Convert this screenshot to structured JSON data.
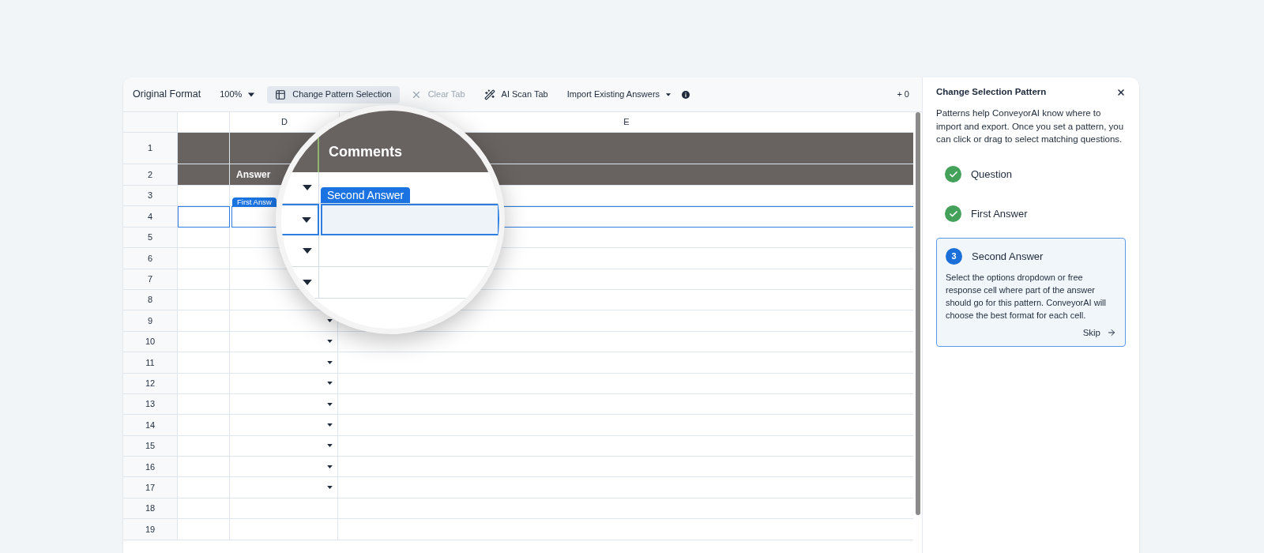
{
  "toolbar": {
    "title": "Original Format",
    "zoom": "100%",
    "buttons": [
      {
        "kind": "table",
        "label": "Change Pattern Selection",
        "selected": true,
        "disabled": false
      },
      {
        "kind": "clear",
        "label": "Clear Tab",
        "selected": false,
        "disabled": true
      },
      {
        "kind": "wand",
        "label": "AI Scan Tab",
        "selected": false,
        "disabled": false
      },
      {
        "kind": "menu",
        "label": "Import Existing Answers",
        "selected": false,
        "disabled": false
      }
    ],
    "counter": "+ 0"
  },
  "sheet": {
    "columns": [
      "D",
      "E"
    ],
    "rows": [
      {
        "label": "1",
        "kind": "header",
        "selected": false
      },
      {
        "label": "2",
        "kind": "header",
        "selected": false,
        "answer": "Answer"
      },
      {
        "label": "3",
        "kind": "data",
        "selected": false
      },
      {
        "label": "4",
        "kind": "data",
        "selected": true,
        "tag": "First Answ"
      },
      {
        "label": "5",
        "kind": "data",
        "selected": false
      },
      {
        "label": "6",
        "kind": "data",
        "selected": false
      },
      {
        "label": "7",
        "kind": "data",
        "selected": false
      },
      {
        "label": "8",
        "kind": "data",
        "selected": false
      },
      {
        "label": "9",
        "kind": "data",
        "selected": false,
        "dropdown": true
      },
      {
        "label": "10",
        "kind": "data",
        "selected": false,
        "dropdown": true
      },
      {
        "label": "11",
        "kind": "data",
        "selected": false,
        "dropdown": true
      },
      {
        "label": "12",
        "kind": "data",
        "selected": false,
        "dropdown": true
      },
      {
        "label": "13",
        "kind": "data",
        "selected": false,
        "dropdown": true
      },
      {
        "label": "14",
        "kind": "data",
        "selected": false,
        "dropdown": true
      },
      {
        "label": "15",
        "kind": "data",
        "selected": false,
        "dropdown": true
      },
      {
        "label": "16",
        "kind": "data",
        "selected": false,
        "dropdown": true
      },
      {
        "label": "17",
        "kind": "data",
        "selected": false,
        "dropdown": true
      },
      {
        "label": "18",
        "kind": "data",
        "selected": false,
        "dropdown": false
      },
      {
        "label": "19",
        "kind": "data",
        "selected": false,
        "dropdown": false
      }
    ]
  },
  "magnifier": {
    "header": "Comments",
    "tag": "Second Answer",
    "rows": [
      {
        "dropdown": true,
        "selected": false
      },
      {
        "dropdown": true,
        "selected": true
      },
      {
        "dropdown": true,
        "selected": false
      },
      {
        "dropdown": true,
        "selected": false
      }
    ]
  },
  "panel": {
    "title": "Change Selection Pattern",
    "intro": "Patterns help ConveyorAI know where to import and export. Once you set a pattern, you can click or drag to select matching questions.",
    "steps": [
      {
        "label": "Question",
        "completed": true,
        "selected": false
      },
      {
        "label": "First Answer",
        "completed": true,
        "selected": false
      },
      {
        "label": "Second Answer",
        "completed": false,
        "selected": true,
        "number": "3",
        "description": "Select the options dropdown or free response cell where part of the answer should go for this pattern. ConveyorAI will choose the best format for each cell.",
        "skip": "Skip"
      }
    ]
  }
}
